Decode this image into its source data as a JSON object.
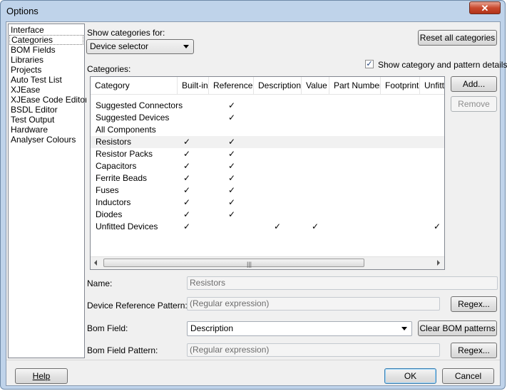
{
  "window": {
    "title": "Options",
    "close_glyph": "✕"
  },
  "nav": {
    "items": [
      "Interface",
      "Categories",
      "BOM Fields",
      "Libraries",
      "Projects",
      "Auto Test List",
      "XJEase",
      "XJEase Code Editor",
      "BSDL Editor",
      "Test Output",
      "Hardware",
      "Analyser Colours"
    ],
    "selected": "Categories"
  },
  "panel": {
    "show_categories_label": "Show categories for:",
    "show_categories_value": "Device selector",
    "reset_button": "Reset all categories",
    "show_details_label": "Show category and pattern details",
    "show_details_checked": true,
    "categories_label": "Categories:",
    "add_button": "Add...",
    "remove_button": "Remove",
    "columns": [
      "Category",
      "Built-in",
      "Reference",
      "Description",
      "Value",
      "Part Number",
      "Footprint",
      "Unfitted"
    ],
    "rows": [
      {
        "name": "Suggested Connectors",
        "builtin": "",
        "reference": "✓",
        "description": "",
        "value": "",
        "unfitted": ""
      },
      {
        "name": "Suggested Devices",
        "builtin": "",
        "reference": "✓",
        "description": "",
        "value": "",
        "unfitted": ""
      },
      {
        "name": "All Components",
        "builtin": "",
        "reference": "",
        "description": "",
        "value": "",
        "unfitted": ""
      },
      {
        "name": "Resistors",
        "builtin": "✓",
        "reference": "✓",
        "description": "",
        "value": "",
        "unfitted": ""
      },
      {
        "name": "Resistor Packs",
        "builtin": "✓",
        "reference": "✓",
        "description": "",
        "value": "",
        "unfitted": ""
      },
      {
        "name": "Capacitors",
        "builtin": "✓",
        "reference": "✓",
        "description": "",
        "value": "",
        "unfitted": ""
      },
      {
        "name": "Ferrite Beads",
        "builtin": "✓",
        "reference": "✓",
        "description": "",
        "value": "",
        "unfitted": ""
      },
      {
        "name": "Fuses",
        "builtin": "✓",
        "reference": "✓",
        "description": "",
        "value": "",
        "unfitted": ""
      },
      {
        "name": "Inductors",
        "builtin": "✓",
        "reference": "✓",
        "description": "",
        "value": "",
        "unfitted": ""
      },
      {
        "name": "Diodes",
        "builtin": "✓",
        "reference": "✓",
        "description": "",
        "value": "",
        "unfitted": ""
      },
      {
        "name": "Unfitted Devices",
        "builtin": "✓",
        "reference": "",
        "description": "✓",
        "value": "✓",
        "unfitted": "✓"
      }
    ],
    "scroll_grip": "|||",
    "name_label": "Name:",
    "name_value": "Resistors",
    "ref_pattern_label": "Device Reference Pattern:",
    "ref_pattern_placeholder": "(Regular expression)",
    "regex_button": "Regex...",
    "bom_field_label": "Bom Field:",
    "bom_field_value": "Description",
    "clear_bom_button": "Clear BOM patterns",
    "bom_pattern_label": "Bom Field Pattern:",
    "bom_pattern_placeholder": "(Regular expression)",
    "regex_button_2": "Regex..."
  },
  "footer": {
    "help_button": "Help",
    "ok_button": "OK",
    "cancel_button": "Cancel"
  }
}
